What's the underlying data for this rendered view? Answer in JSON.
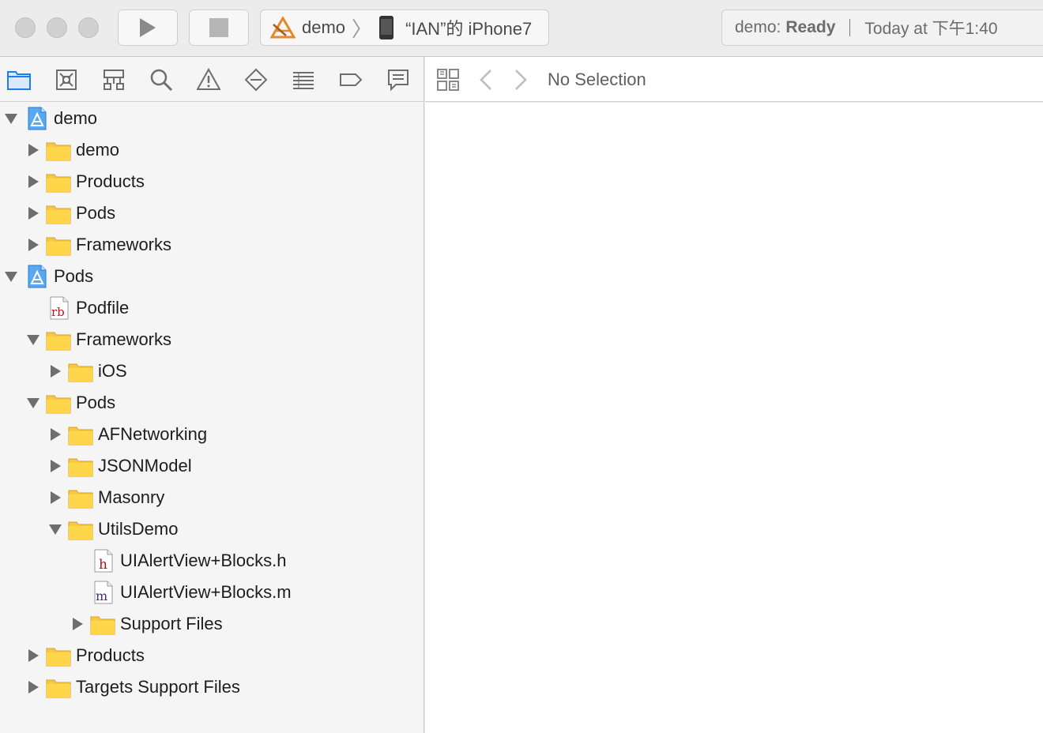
{
  "toolbar": {
    "scheme": {
      "target": "demo",
      "device": "“IAN”的 iPhone7"
    },
    "status": {
      "prefix": "demo:",
      "state": "Ready",
      "time": "Today at 下午1:40"
    }
  },
  "navigator": {
    "tab_icons": [
      "project-navigator-icon",
      "source-control-icon",
      "symbol-navigator-icon",
      "find-icon",
      "issue-icon",
      "test-icon",
      "debug-icon",
      "breakpoint-icon",
      "report-icon"
    ],
    "tree": [
      {
        "label": "demo",
        "depth": 0,
        "kind": "project",
        "disclosure": "down"
      },
      {
        "label": "demo",
        "depth": 1,
        "kind": "folder",
        "disclosure": "right"
      },
      {
        "label": "Products",
        "depth": 1,
        "kind": "folder",
        "disclosure": "right"
      },
      {
        "label": "Pods",
        "depth": 1,
        "kind": "folder",
        "disclosure": "right"
      },
      {
        "label": "Frameworks",
        "depth": 1,
        "kind": "folder",
        "disclosure": "right"
      },
      {
        "label": "Pods",
        "depth": 0,
        "kind": "project",
        "disclosure": "down"
      },
      {
        "label": "Podfile",
        "depth": 1,
        "kind": "ruby",
        "disclosure": "none"
      },
      {
        "label": "Frameworks",
        "depth": 1,
        "kind": "folder",
        "disclosure": "down"
      },
      {
        "label": "iOS",
        "depth": 2,
        "kind": "folder",
        "disclosure": "right"
      },
      {
        "label": "Pods",
        "depth": 1,
        "kind": "folder",
        "disclosure": "down"
      },
      {
        "label": "AFNetworking",
        "depth": 2,
        "kind": "folder",
        "disclosure": "right"
      },
      {
        "label": "JSONModel",
        "depth": 2,
        "kind": "folder",
        "disclosure": "right"
      },
      {
        "label": "Masonry",
        "depth": 2,
        "kind": "folder",
        "disclosure": "right"
      },
      {
        "label": "UtilsDemo",
        "depth": 2,
        "kind": "folder",
        "disclosure": "down"
      },
      {
        "label": "UIAlertView+Blocks.h",
        "depth": 3,
        "kind": "header",
        "disclosure": "none"
      },
      {
        "label": "UIAlertView+Blocks.m",
        "depth": 3,
        "kind": "source",
        "disclosure": "none"
      },
      {
        "label": "Support Files",
        "depth": 3,
        "kind": "folder",
        "disclosure": "right"
      },
      {
        "label": "Products",
        "depth": 1,
        "kind": "folder",
        "disclosure": "right"
      },
      {
        "label": "Targets Support Files",
        "depth": 1,
        "kind": "folder",
        "disclosure": "right"
      }
    ]
  },
  "editor": {
    "empty_label": "No Selection"
  }
}
